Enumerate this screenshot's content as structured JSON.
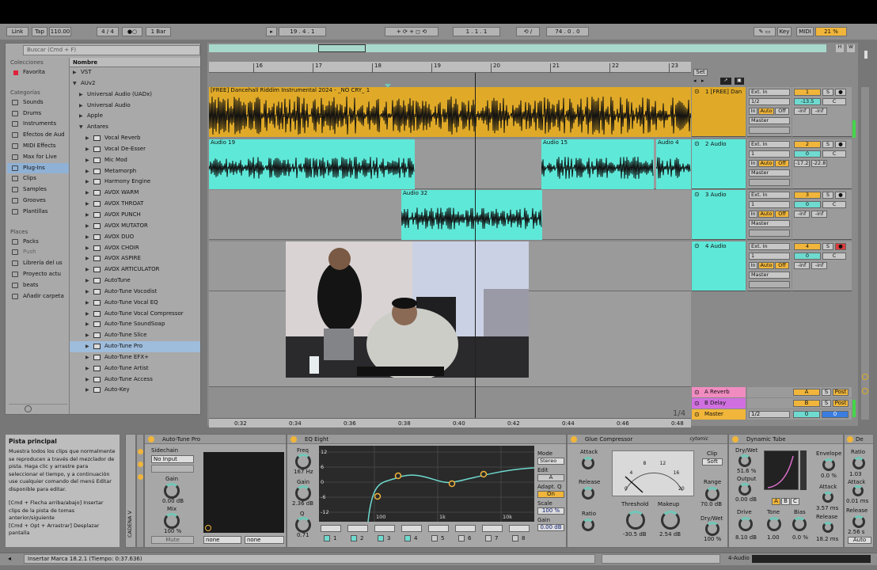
{
  "control_bar": {
    "link": "Link",
    "tap": "Tap",
    "tempo": "110.00",
    "signature": "4 / 4",
    "metronome": "1 Bar",
    "position": "19 .   4 .   1",
    "loop_start": "1 .   1 .   1",
    "loop_length": "74 .   0 .   0",
    "key": "Key",
    "midi": "MIDI",
    "cpu": "21 %"
  },
  "browser": {
    "search_placeholder": "Buscar (Cmd + F)",
    "collections_header": "Colecciones",
    "favorites": "Favorita",
    "categories_header": "Categorías",
    "categories": [
      "Sounds",
      "Drums",
      "Instruments",
      "Efectos de Aud",
      "MIDI Effects",
      "Max for Live",
      "Plug-Ins",
      "Clips",
      "Samples",
      "Grooves",
      "Plantillas"
    ],
    "places_header": "Places",
    "places": [
      "Packs",
      "Push",
      "Librería del us",
      "Proyecto actu",
      "beats",
      "Añadir carpeta"
    ],
    "name_header": "Nombre",
    "items": [
      {
        "label": "VST",
        "indent": 0
      },
      {
        "label": "AUv2",
        "indent": 0
      },
      {
        "label": "Universal Audio (UADx)",
        "indent": 1
      },
      {
        "label": "Universal Audio",
        "indent": 1
      },
      {
        "label": "Apple",
        "indent": 1
      },
      {
        "label": "Antares",
        "indent": 1
      },
      {
        "label": "Vocal Reverb",
        "indent": 2
      },
      {
        "label": "Vocal De-Esser",
        "indent": 2
      },
      {
        "label": "Mic Mod",
        "indent": 2
      },
      {
        "label": "Metamorph",
        "indent": 2
      },
      {
        "label": "Harmony Engine",
        "indent": 2
      },
      {
        "label": "AVOX WARM",
        "indent": 2
      },
      {
        "label": "AVOX THROAT",
        "indent": 2
      },
      {
        "label": "AVOX PUNCH",
        "indent": 2
      },
      {
        "label": "AVOX MUTATOR",
        "indent": 2
      },
      {
        "label": "AVOX DUO",
        "indent": 2
      },
      {
        "label": "AVOX CHOIR",
        "indent": 2
      },
      {
        "label": "AVOX ASPIRE",
        "indent": 2
      },
      {
        "label": "AVOX ARTICULATOR",
        "indent": 2
      },
      {
        "label": "AutoTune",
        "indent": 2
      },
      {
        "label": "Auto-Tune Vocodist",
        "indent": 2
      },
      {
        "label": "Auto-Tune Vocal EQ",
        "indent": 2
      },
      {
        "label": "Auto-Tune Vocal Compressor",
        "indent": 2
      },
      {
        "label": "Auto-Tune SoundSoap",
        "indent": 2
      },
      {
        "label": "Auto-Tune Slice",
        "indent": 2
      },
      {
        "label": "Auto-Tune Pro",
        "indent": 2
      },
      {
        "label": "Auto-Tune EFX+",
        "indent": 2
      },
      {
        "label": "Auto-Tune Artist",
        "indent": 2
      },
      {
        "label": "Auto-Tune Access",
        "indent": 2
      },
      {
        "label": "Auto-Key",
        "indent": 2
      }
    ]
  },
  "ruler": {
    "bars": [
      "16",
      "17",
      "18",
      "19",
      "20",
      "21",
      "22",
      "23"
    ],
    "set": "Set"
  },
  "time_ruler": [
    "0:32",
    "0:34",
    "0:36",
    "0:38",
    "0:40",
    "0:42",
    "0:44",
    "0:46",
    "0:48"
  ],
  "page_indicator": "1/4",
  "tracks": [
    {
      "name": "1 [FREE] Dan",
      "color": "#e0aa28",
      "input": "Ext. In",
      "channel": "1/2",
      "monitor": [
        "In",
        "Auto",
        "Off"
      ],
      "output": "Master",
      "number": "1",
      "vol": "-13.5",
      "pan": "C",
      "vols": [
        "-inf",
        "-inf"
      ],
      "clips": [
        "[FREE] Dancehall Riddim Instrumental 2024 - _NO CRY_ 1"
      ]
    },
    {
      "name": "2 Audio",
      "color": "#5ee8d8",
      "input": "Ext. In",
      "channel": "1",
      "monitor": [
        "In",
        "Auto",
        "Off"
      ],
      "output": "Master",
      "number": "2",
      "vol": "0",
      "pan": "C",
      "vols": [
        "-17.2",
        "-22.8"
      ],
      "clips": [
        "Audio 19",
        "Audio 15",
        "Audio 4"
      ]
    },
    {
      "name": "3 Audio",
      "color": "#5ee8d8",
      "input": "Ext. In",
      "channel": "1",
      "monitor": [
        "In",
        "Auto",
        "Off"
      ],
      "output": "Master",
      "number": "3",
      "vol": "0",
      "pan": "C",
      "vols": [
        "-inf",
        "-inf"
      ],
      "clips": [
        "Audio 32"
      ]
    },
    {
      "name": "4 Audio",
      "color": "#5ee8d8",
      "input": "Ext. In",
      "channel": "1",
      "monitor": [
        "In",
        "Auto",
        "Off"
      ],
      "output": "Master",
      "number": "4",
      "vol": "0",
      "pan": "C",
      "vols": [
        "-inf",
        "-inf"
      ],
      "clips": []
    }
  ],
  "returns": [
    {
      "name": "A Reverb",
      "color": "#f08cc0",
      "letter": "A",
      "post": "Post"
    },
    {
      "name": "B Delay",
      "color": "#d070e0",
      "letter": "B",
      "post": "Post"
    },
    {
      "name": "Master",
      "color": "#f0b53a",
      "channel": "1/2",
      "vol": "0",
      "pan": "0"
    }
  ],
  "info_panel": {
    "title": "Pista principal",
    "body": "Muestra todos los clips que normalmente se reproducen a través del mezclador de pista. Haga clic y arrastre para seleccionar el tiempo, y a continuación use cualquier comando del menú Editar disponible para editar.",
    "shortcut1": "[Cmd + Flecha arriba/abajo] Insertar clips de la pista de tomas anterior/siguiente",
    "shortcut2": "[Cmd + Opt + Arrastrar] Desplazar pantalla"
  },
  "devices": {
    "rack_label": "CADENA V",
    "autotune": {
      "title": "Auto-Tune Pro",
      "sidechain": "Sidechain",
      "input": "No Input",
      "gain_label": "Gain",
      "gain": "0.00 dB",
      "mix_label": "Mix",
      "mix": "100 %",
      "mute": "Mute",
      "out1": "none",
      "out2": "none"
    },
    "eq": {
      "title": "EQ Eight",
      "freq_label": "Freq",
      "freq": "167 Hz",
      "gain_label": "Gain",
      "gain": "2.36 dB",
      "q_label": "Q",
      "q": "0.71",
      "y_ticks": [
        "12",
        "6",
        "0",
        "-6",
        "-12"
      ],
      "x_ticks": [
        "100",
        "1k",
        "10k"
      ],
      "mode_label": "Mode",
      "mode": "Stereo",
      "edit_label": "Edit",
      "edit": "A",
      "adapt_label": "Adapt. Q",
      "adapt": "On",
      "scale_label": "Scale",
      "scale": "100 %",
      "gain2_label": "Gain",
      "gain2": "0.00 dB",
      "bands": [
        "1",
        "2",
        "3",
        "4",
        "5",
        "6",
        "7",
        "8"
      ]
    },
    "glue": {
      "title": "Glue Compressor",
      "brand": "cytomic",
      "attack_label": "Attack",
      "release_label": "Release",
      "ratio_label": "Ratio",
      "threshold_label": "Threshold",
      "threshold": "-30.5 dB",
      "makeup_label": "Makeup",
      "makeup": "2.54 dB",
      "clip_label": "Clip",
      "soft": "Soft",
      "range_label": "Range",
      "range": "70.0 dB",
      "drywet_label": "Dry/Wet",
      "drywet": "100 %",
      "meter_ticks": [
        "0",
        "4",
        "8",
        "12",
        "16",
        "20"
      ]
    },
    "tube": {
      "title": "Dynamic Tube",
      "drywet_label": "Dry/Wet",
      "drywet": "51.6 %",
      "output_label": "Output",
      "output": "0.00 dB",
      "drive_label": "Drive",
      "drive": "8.10 dB",
      "tone_label": "Tone",
      "tone": "1.00",
      "bias_label": "Bias",
      "bias": "0.0 %",
      "envelope_label": "Envelope",
      "envelope": "0.0 %",
      "attack_label": "Attack",
      "attack": "3.57 ms",
      "release_label": "Release",
      "release": "18.2 ms",
      "abc": [
        "A",
        "B",
        "C"
      ]
    },
    "last": {
      "title": "De",
      "ratio_label": "Ratio",
      "ratio": "1.03",
      "attack_label": "Attack",
      "attack": "0.01 ms",
      "release_label": "Release",
      "release": "2.56 s",
      "auto": "Auto"
    }
  },
  "status": {
    "text": "Insertar Marca 18.2.1 (Tiempo: 0:37.636)",
    "track": "4-Audio"
  }
}
